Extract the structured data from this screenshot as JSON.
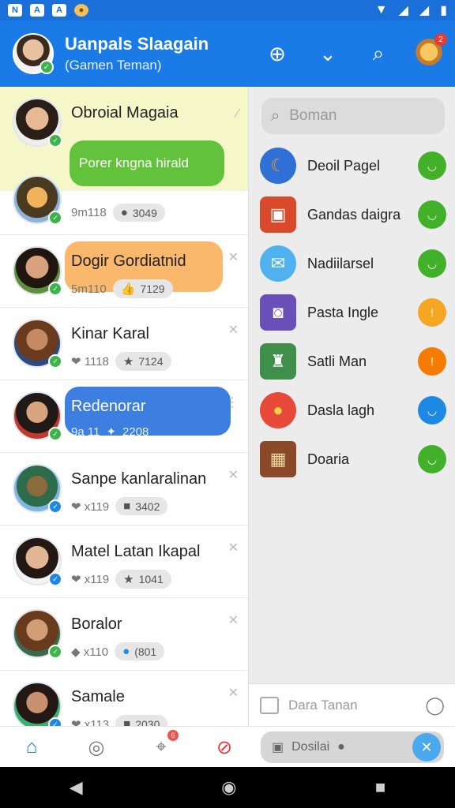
{
  "status_bar": {
    "icons_left": [
      "N",
      "A",
      "A",
      "●"
    ],
    "icons_right": [
      "wifi",
      "signal",
      "signal",
      "battery"
    ]
  },
  "header": {
    "title": "Uanpals Slaagain",
    "subtitle": "(Gamen Teman)",
    "actions": [
      "compass-icon",
      "chevron-down-icon",
      "search-icon",
      "mascot-icon"
    ],
    "mascot_badge": "2"
  },
  "chats": [
    {
      "name": "Obroial Magaia",
      "message": "Porer kngna hirald",
      "highlight": "yellow"
    },
    {
      "name": "",
      "meta_left": "9m118",
      "meta_pill": "3049"
    },
    {
      "name": "Dogir Gordiatnid",
      "meta_left": "5m110",
      "meta_pill": "7129",
      "highlight": "orange"
    },
    {
      "name": "Kinar Karal",
      "meta_left": "❤ 1118",
      "meta_pill": "7124"
    },
    {
      "name": "Redenorar",
      "meta_left": "9a 11",
      "meta_pill": "2208",
      "highlight": "blue"
    },
    {
      "name": "Sanpe kanlaralinan",
      "meta_left": "❤ x119",
      "meta_pill": "3402"
    },
    {
      "name": "Matel Latan Ikapal",
      "meta_left": "❤ x119",
      "meta_pill": "1041"
    },
    {
      "name": "Boralor",
      "meta_left": "◆ x110",
      "meta_pill": "(801"
    },
    {
      "name": "Samale",
      "meta_left": "❤ x113",
      "meta_pill": "2030"
    }
  ],
  "drawer": {
    "search_placeholder": "Boman",
    "apps": [
      {
        "name": "Deoil Pagel",
        "dot_color": "#43b02a"
      },
      {
        "name": "Gandas daigra",
        "dot_color": "#43b02a"
      },
      {
        "name": "Nadiilarsel",
        "dot_color": "#43b02a"
      },
      {
        "name": "Pasta Ingle",
        "dot_color": "#f5a623"
      },
      {
        "name": "Satli Man",
        "dot_color": "#f57c00"
      },
      {
        "name": "Dasla lagh",
        "dot_color": "#1e88e5"
      },
      {
        "name": "Doaria",
        "dot_color": "#43b02a"
      }
    ],
    "footer_label": "Dara Tanan"
  },
  "bottom_nav": {
    "compose_label": "Dosilai",
    "badge": "6"
  }
}
